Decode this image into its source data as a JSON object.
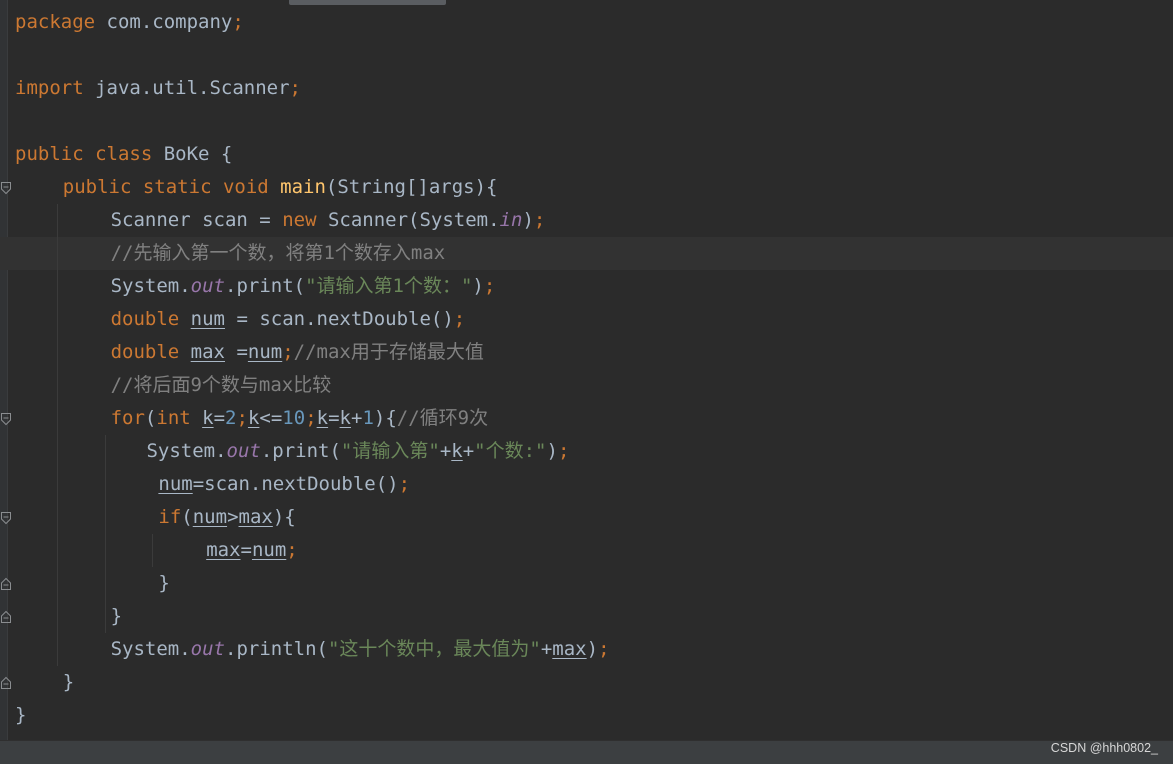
{
  "code_lines": [
    {
      "indent": 0,
      "current": false,
      "tokens": [
        [
          "package",
          "kw"
        ],
        [
          " com.company",
          "plain"
        ],
        [
          ";",
          "kw"
        ]
      ]
    },
    {
      "indent": 0,
      "current": false,
      "tokens": []
    },
    {
      "indent": 0,
      "current": false,
      "tokens": [
        [
          "import",
          "kw"
        ],
        [
          " java.util.Scanner",
          "plain"
        ],
        [
          ";",
          "kw"
        ]
      ]
    },
    {
      "indent": 0,
      "current": false,
      "tokens": []
    },
    {
      "indent": 0,
      "current": false,
      "tokens": [
        [
          "public class ",
          "kw"
        ],
        [
          "BoKe {",
          "plain"
        ]
      ]
    },
    {
      "indent": 4,
      "current": false,
      "tokens": [
        [
          "public static void ",
          "kw"
        ],
        [
          "main",
          "method"
        ],
        [
          "(String[]args){",
          "plain"
        ]
      ]
    },
    {
      "indent": 8,
      "current": false,
      "tokens": [
        [
          "Scanner scan = ",
          "plain"
        ],
        [
          "new ",
          "kw"
        ],
        [
          "Scanner(System.",
          "plain"
        ],
        [
          "in",
          "static"
        ],
        [
          ")",
          "plain"
        ],
        [
          ";",
          "kw"
        ]
      ]
    },
    {
      "indent": 8,
      "current": true,
      "tokens": [
        [
          "//先输入第一个数，将第1个数存入max",
          "comment"
        ]
      ]
    },
    {
      "indent": 8,
      "current": false,
      "tokens": [
        [
          "System.",
          "plain"
        ],
        [
          "out",
          "static"
        ],
        [
          ".print(",
          "plain"
        ],
        [
          "\"请输入第1个数：\"",
          "string"
        ],
        [
          ")",
          "plain"
        ],
        [
          ";",
          "kw"
        ]
      ]
    },
    {
      "indent": 8,
      "current": false,
      "tokens": [
        [
          "double ",
          "kw"
        ],
        [
          "num",
          "var"
        ],
        [
          " = scan.nextDouble()",
          "plain"
        ],
        [
          ";",
          "kw"
        ]
      ]
    },
    {
      "indent": 8,
      "current": false,
      "tokens": [
        [
          "double ",
          "kw"
        ],
        [
          "max",
          "var"
        ],
        [
          " =",
          "plain"
        ],
        [
          "num",
          "var"
        ],
        [
          ";",
          "kw"
        ],
        [
          "//max用于存储最大值",
          "comment"
        ]
      ]
    },
    {
      "indent": 8,
      "current": false,
      "tokens": [
        [
          "//将后面9个数与max比较",
          "comment"
        ]
      ]
    },
    {
      "indent": 8,
      "current": false,
      "tokens": [
        [
          "for",
          "kw"
        ],
        [
          "(",
          "plain"
        ],
        [
          "int ",
          "kw"
        ],
        [
          "k",
          "var"
        ],
        [
          "=",
          "plain"
        ],
        [
          "2",
          "number"
        ],
        [
          ";",
          "kw"
        ],
        [
          "k",
          "var"
        ],
        [
          "<=",
          "plain"
        ],
        [
          "10",
          "number"
        ],
        [
          ";",
          "kw"
        ],
        [
          "k",
          "var"
        ],
        [
          "=",
          "plain"
        ],
        [
          "k",
          "var"
        ],
        [
          "+",
          "plain"
        ],
        [
          "1",
          "number"
        ],
        [
          "){",
          "plain"
        ],
        [
          "//循环9次",
          "comment"
        ]
      ]
    },
    {
      "indent": 11,
      "current": false,
      "tokens": [
        [
          "System.",
          "plain"
        ],
        [
          "out",
          "static"
        ],
        [
          ".print(",
          "plain"
        ],
        [
          "\"请输入第\"",
          "string"
        ],
        [
          "+",
          "plain"
        ],
        [
          "k",
          "var"
        ],
        [
          "+",
          "plain"
        ],
        [
          "\"个数:\"",
          "string"
        ],
        [
          ")",
          "plain"
        ],
        [
          ";",
          "kw"
        ]
      ]
    },
    {
      "indent": 12,
      "current": false,
      "tokens": [
        [
          "num",
          "var"
        ],
        [
          "=scan.nextDouble()",
          "plain"
        ],
        [
          ";",
          "kw"
        ]
      ]
    },
    {
      "indent": 12,
      "current": false,
      "tokens": [
        [
          "if",
          "kw"
        ],
        [
          "(",
          "plain"
        ],
        [
          "num",
          "var"
        ],
        [
          ">",
          "plain"
        ],
        [
          "max",
          "var"
        ],
        [
          "){",
          "plain"
        ]
      ]
    },
    {
      "indent": 16,
      "current": false,
      "tokens": [
        [
          "max",
          "var"
        ],
        [
          "=",
          "plain"
        ],
        [
          "num",
          "var"
        ],
        [
          ";",
          "kw"
        ]
      ]
    },
    {
      "indent": 12,
      "current": false,
      "tokens": [
        [
          "}",
          "plain"
        ]
      ]
    },
    {
      "indent": 8,
      "current": false,
      "tokens": [
        [
          "}",
          "plain"
        ]
      ]
    },
    {
      "indent": 8,
      "current": false,
      "tokens": [
        [
          "System.",
          "plain"
        ],
        [
          "out",
          "static"
        ],
        [
          ".println(",
          "plain"
        ],
        [
          "\"这十个数中，最大值为\"",
          "string"
        ],
        [
          "+",
          "plain"
        ],
        [
          "max",
          "var"
        ],
        [
          ")",
          "plain"
        ],
        [
          ";",
          "kw"
        ]
      ]
    },
    {
      "indent": 4,
      "current": false,
      "tokens": [
        [
          "}",
          "plain"
        ]
      ]
    },
    {
      "indent": 0,
      "current": false,
      "tokens": [
        [
          "}",
          "plain"
        ]
      ]
    }
  ],
  "fold_markers": [
    {
      "line": 5,
      "kind": "open"
    },
    {
      "line": 12,
      "kind": "open"
    },
    {
      "line": 15,
      "kind": "open"
    },
    {
      "line": 17,
      "kind": "close"
    },
    {
      "line": 18,
      "kind": "close"
    },
    {
      "line": 20,
      "kind": "close"
    }
  ],
  "watermark": "CSDN @hhh0802_",
  "colors": {
    "background": "#2b2b2b",
    "keyword": "#cc7832",
    "plain": "#a9b7c6",
    "method": "#ffc66d",
    "static_field": "#9876aa",
    "string": "#6a8759",
    "number": "#6897bb",
    "comment": "#808080"
  }
}
